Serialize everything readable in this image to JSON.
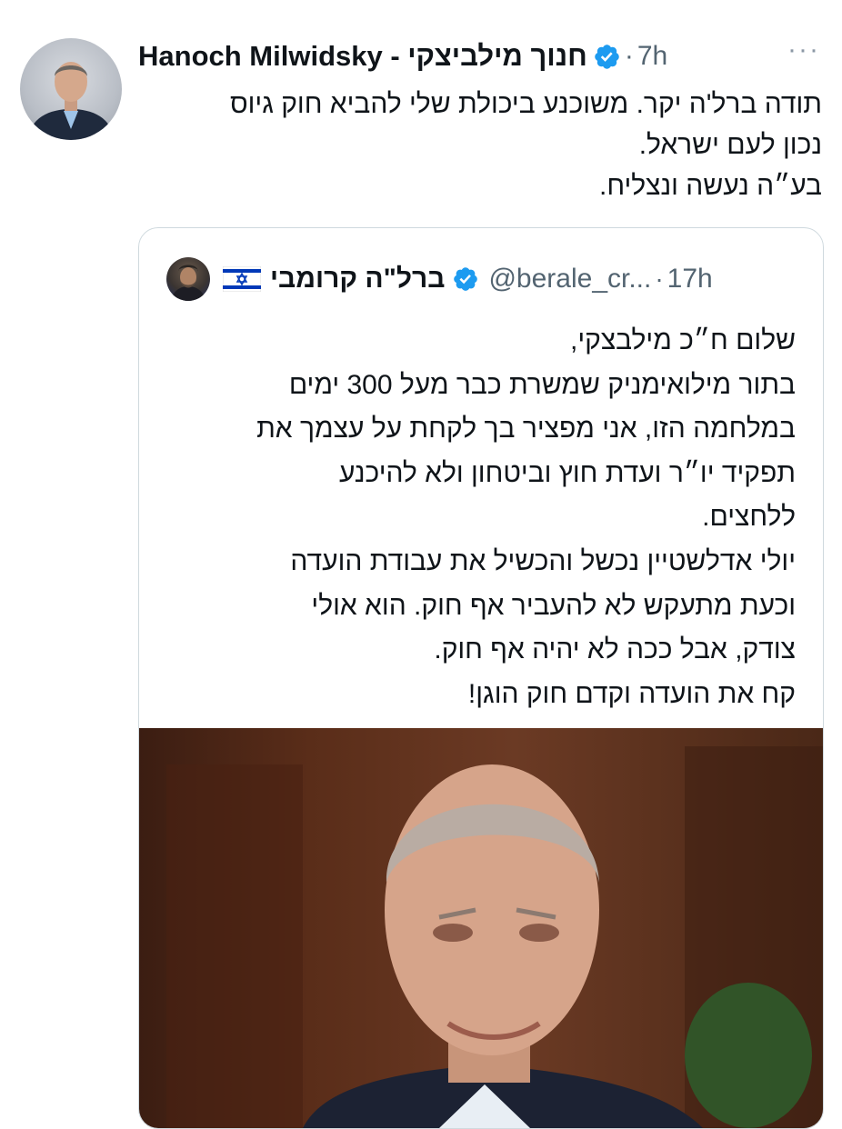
{
  "tweet": {
    "author_name": "Hanoch Milwidsky - חנוך מילביצקי",
    "separator": "·",
    "time": "7h",
    "more_label": "···",
    "text": "תודה ברל'ה יקר. משוכנע ביכולת שלי להביא חוק גיוס\nנכון לעם ישראל.\nבע״ה נעשה ונצליח."
  },
  "quoted": {
    "display_name": "ברל\"ה קרומבי",
    "flag_emoji": "israel-flag",
    "handle": "@berale_cr...",
    "separator": "·",
    "time": "17h",
    "text": "שלום ח״כ מילבצקי,\nבתור מילואימניק שמשרת כבר מעל 300 ימים\nבמלחמה הזו, אני מפציר בך לקחת על עצמך את\nתפקיד יו״ר ועדת חוץ וביטחון ולא להיכנע\nללחצים.\nיולי אדלשטיין נכשל והכשיל את עבודת הועדה\nוכעת מתעקש לא להעביר אף חוק. הוא אולי\nצודק, אבל ככה לא יהיה אף חוק.\nקח את הועדה וקדם חוק הוגן!"
  },
  "colors": {
    "verified": "#1d9bf0",
    "secondary_text": "#536471",
    "border": "#cfd9de",
    "flag_blue": "#0038b8"
  }
}
